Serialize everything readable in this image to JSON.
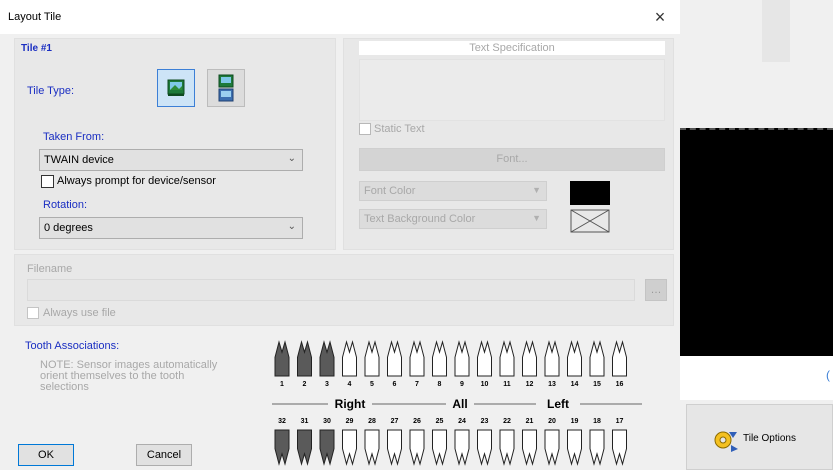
{
  "dialog": {
    "title": "Layout Tile",
    "close": "×"
  },
  "tile": {
    "header": "Tile #1",
    "type_label": "Tile Type:",
    "type_buttons": [
      {
        "name": "image-tile",
        "selected": true
      },
      {
        "name": "sensor-tile",
        "selected": false
      }
    ],
    "taken_from_label": "Taken From:",
    "taken_from_value": "TWAIN device",
    "prompt_label": "Always prompt for device/sensor",
    "prompt_checked": false,
    "rotation_label": "Rotation:",
    "rotation_value": "0 degrees"
  },
  "spec": {
    "header": "Text Specification",
    "static_text_label": "Static Text",
    "font_button": "Font...",
    "select_a": "Font Color",
    "select_b": "Text Background Color"
  },
  "file": {
    "label": "Filename",
    "always_use_label": "Always use file"
  },
  "tooth": {
    "title": "Tooth Associations:",
    "note": "NOTE: Sensor images automatically orient themselves to the tooth selections",
    "upper_numbers": [
      "1",
      "2",
      "3",
      "4",
      "5",
      "6",
      "7",
      "8",
      "9",
      "10",
      "11",
      "12",
      "13",
      "14",
      "15",
      "16"
    ],
    "lower_numbers": [
      "32",
      "31",
      "30",
      "29",
      "28",
      "27",
      "26",
      "25",
      "24",
      "23",
      "22",
      "21",
      "20",
      "19",
      "18",
      "17"
    ],
    "right_label": "Right",
    "all_label": "All",
    "left_label": "Left"
  },
  "buttons": {
    "ok": "OK",
    "cancel": "Cancel"
  },
  "background": {
    "tile_options_label": "Tile Options",
    "blue_mark": "("
  },
  "colors": {
    "accent": "#1a2ec2",
    "focus_border": "#0078d7"
  }
}
